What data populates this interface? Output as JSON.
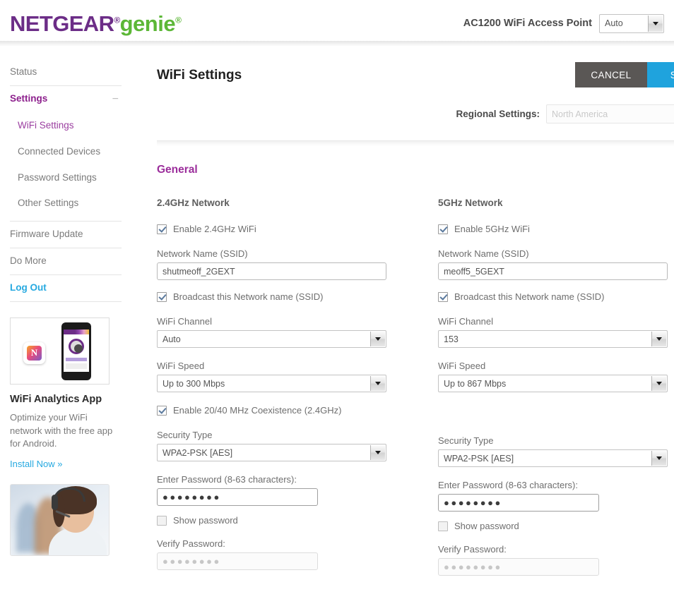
{
  "header": {
    "logo_netgear": "NETGEAR",
    "logo_genie": "genie",
    "registered_mark": "®",
    "device_name": "AC1200 WiFi Access Point",
    "mode_select_value": "Auto"
  },
  "sidebar": {
    "items": [
      {
        "label": "Status"
      },
      {
        "label": "Settings",
        "toggle": "−"
      },
      {
        "label": "WiFi Settings"
      },
      {
        "label": "Connected Devices"
      },
      {
        "label": "Password Settings"
      },
      {
        "label": "Other Settings"
      },
      {
        "label": "Firmware Update"
      },
      {
        "label": "Do More",
        "toggle": "+"
      },
      {
        "label": "Log Out"
      }
    ],
    "promo": {
      "app_letter": "N",
      "title": "WiFi Analytics App",
      "description": "Optimize your WiFi network with the free app for Android.",
      "link": "Install Now »"
    }
  },
  "main": {
    "page_title": "WiFi Settings",
    "cancel_label": "CANCEL",
    "save_label": "SAVE",
    "regional_label": "Regional Settings:",
    "regional_value": "North America",
    "section_title": "General",
    "section_toggle": "−",
    "networks": [
      {
        "title": "2.4GHz Network",
        "enable_label": "Enable 2.4GHz WiFi",
        "enable_checked": true,
        "ssid_label": "Network Name (SSID)",
        "ssid_value": "shutmeoff_2GEXT",
        "broadcast_label": "Broadcast this Network name (SSID)",
        "broadcast_checked": true,
        "channel_label": "WiFi Channel",
        "channel_value": "Auto",
        "speed_label": "WiFi Speed",
        "speed_value": "Up to 300 Mbps",
        "coexistence_label": "Enable 20/40 MHz Coexistence (2.4GHz)",
        "coexistence_checked": true,
        "security_label": "Security Type",
        "security_value": "WPA2-PSK [AES]",
        "password_label": "Enter Password (8-63 characters):",
        "password_value": "●●●●●●●●",
        "show_password_label": "Show password",
        "show_password_checked": false,
        "verify_label": "Verify Password:",
        "verify_value": "●●●●●●●●"
      },
      {
        "title": "5GHz Network",
        "enable_label": "Enable 5GHz WiFi",
        "enable_checked": true,
        "ssid_label": "Network Name (SSID)",
        "ssid_value": "meoff5_5GEXT",
        "broadcast_label": "Broadcast this Network name (SSID)",
        "broadcast_checked": true,
        "channel_label": "WiFi Channel",
        "channel_value": "153",
        "speed_label": "WiFi Speed",
        "speed_value": "Up to 867 Mbps",
        "security_label": "Security Type",
        "security_value": "WPA2-PSK [AES]",
        "password_label": "Enter Password (8-63 characters):",
        "password_value": "●●●●●●●●",
        "show_password_label": "Show password",
        "show_password_checked": false,
        "verify_label": "Verify Password:",
        "verify_value": "●●●●●●●●"
      }
    ]
  },
  "colors": {
    "brand_purple": "#6c2d87",
    "brand_green": "#5cb737",
    "accent_cyan": "#26a9e0",
    "save_blue": "#1fa3dd",
    "cancel_gray": "#5a5755",
    "section_purple": "#9b2d9b"
  }
}
